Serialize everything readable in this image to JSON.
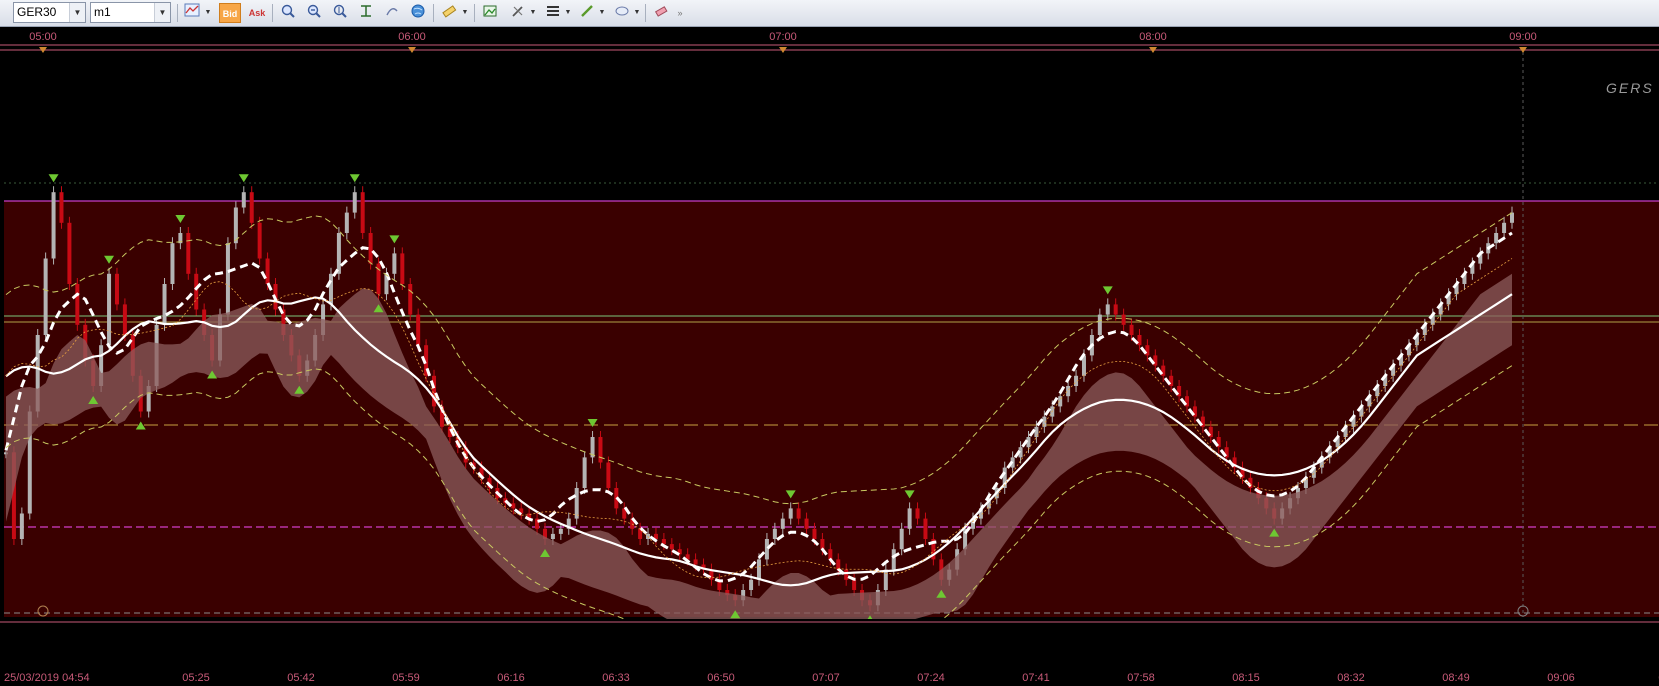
{
  "toolbar": {
    "symbol": "GER30",
    "timeframe": "m1",
    "bid_label": "Bid",
    "ask_label": "Ask"
  },
  "chart": {
    "watermark": "GERS",
    "top_time_labels": [
      "05:00",
      "06:00",
      "07:00",
      "08:00",
      "09:00"
    ],
    "bottom_time_labels": [
      "25/03/2019 04:54",
      "05:25",
      "05:42",
      "05:59",
      "06:16",
      "06:33",
      "06:50",
      "07:07",
      "07:24",
      "07:41",
      "07:58",
      "08:15",
      "08:32",
      "08:49",
      "09:06",
      "09:"
    ],
    "colors": {
      "background": "#000000",
      "zone": "#3a0000",
      "zone_border": "#c83cc8",
      "time_labels": "#c85a78",
      "dashed_marker": "#d23cc8",
      "candle_up": "#b4b4b4",
      "candle_down": "#c80a14",
      "cloud": "#8c5c5c",
      "line": "#ffffff",
      "signal_arrow": "#6ec832"
    }
  },
  "chart_data": {
    "type": "candlestick",
    "symbol": "GER30",
    "timeframe": "m1",
    "date": "25/03/2019",
    "x_ticks": [
      "04:54",
      "05:25",
      "05:42",
      "05:59",
      "06:16",
      "06:33",
      "06:50",
      "07:07",
      "07:24",
      "07:41",
      "07:58",
      "08:15",
      "08:32",
      "08:49",
      "09:06"
    ],
    "indicators": [
      "ichimoku-cloud",
      "bollinger-bands",
      "moving-averages"
    ],
    "close": [
      37,
      20,
      25,
      45,
      60,
      75,
      88,
      82,
      70,
      62,
      55,
      50,
      58,
      72,
      66,
      60,
      52,
      45,
      50,
      62,
      70,
      78,
      80,
      72,
      65,
      60,
      55,
      64,
      78,
      85,
      88,
      82,
      75,
      70,
      65,
      60,
      56,
      52,
      55,
      60,
      66,
      72,
      80,
      84,
      88,
      80,
      74,
      68,
      72,
      76,
      70,
      64,
      58,
      52,
      46,
      42,
      40,
      38,
      35,
      34,
      32,
      30,
      28,
      27,
      26,
      25,
      24,
      22,
      20,
      21,
      22,
      24,
      30,
      36,
      40,
      35,
      30,
      26,
      24,
      22,
      20,
      21,
      20,
      19,
      18,
      17,
      16,
      15,
      14,
      12,
      10,
      9,
      8,
      10,
      12,
      16,
      20,
      22,
      24,
      26,
      24,
      22,
      20,
      18,
      16,
      14,
      12,
      10,
      8,
      7,
      10,
      14,
      18,
      22,
      26,
      24,
      20,
      16,
      12,
      14,
      18,
      22,
      24,
      26,
      28,
      30,
      34,
      36,
      38,
      40,
      42,
      44,
      46,
      48,
      50,
      52,
      56,
      60,
      64,
      66,
      64,
      62,
      60,
      58,
      56,
      54,
      52,
      50,
      48,
      46,
      44,
      42,
      40,
      38,
      36,
      34,
      32,
      30,
      28,
      26,
      24,
      26,
      28,
      30,
      32,
      34,
      36,
      38,
      40,
      42,
      44,
      46,
      48,
      50,
      52,
      54,
      56,
      58,
      60,
      62,
      64,
      66,
      68,
      70,
      72,
      74,
      76,
      78,
      80,
      82,
      84
    ],
    "horizontal_levels": [
      50,
      48,
      32,
      15,
      2
    ]
  }
}
